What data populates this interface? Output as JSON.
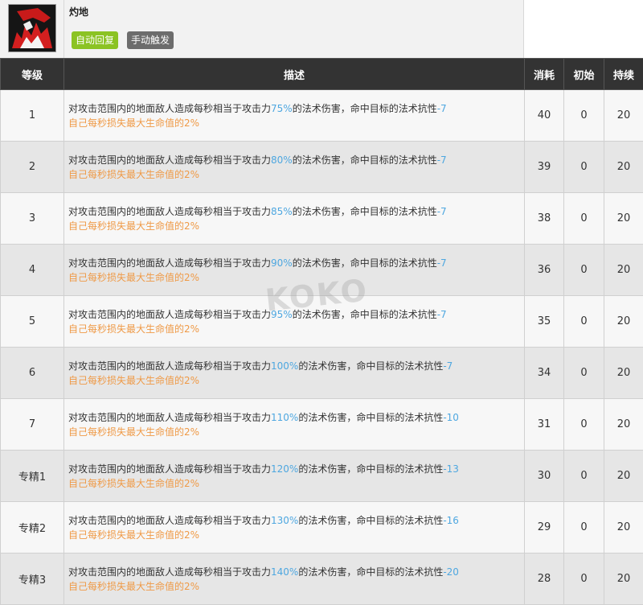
{
  "skill": {
    "name": "灼地",
    "tags": [
      "自动回复",
      "手动触发"
    ],
    "icon": "fire-skill-icon"
  },
  "table": {
    "headers": [
      "等级",
      "描述",
      "消耗",
      "初始",
      "持续"
    ],
    "rows": [
      {
        "level": "1",
        "desc_a": "对攻击范围内的地面敌人造成每秒相当于攻击力",
        "atk": "75%",
        "desc_b": "的法术伤害，命中目标的法术抗性",
        "res": "-7",
        "self": "自己每秒损失最大生命值的2%",
        "cost": "40",
        "init": "0",
        "dur": "20"
      },
      {
        "level": "2",
        "desc_a": "对攻击范围内的地面敌人造成每秒相当于攻击力",
        "atk": "80%",
        "desc_b": "的法术伤害，命中目标的法术抗性",
        "res": "-7",
        "self": "自己每秒损失最大生命值的2%",
        "cost": "39",
        "init": "0",
        "dur": "20"
      },
      {
        "level": "3",
        "desc_a": "对攻击范围内的地面敌人造成每秒相当于攻击力",
        "atk": "85%",
        "desc_b": "的法术伤害，命中目标的法术抗性",
        "res": "-7",
        "self": "自己每秒损失最大生命值的2%",
        "cost": "38",
        "init": "0",
        "dur": "20"
      },
      {
        "level": "4",
        "desc_a": "对攻击范围内的地面敌人造成每秒相当于攻击力",
        "atk": "90%",
        "desc_b": "的法术伤害，命中目标的法术抗性",
        "res": "-7",
        "self": "自己每秒损失最大生命值的2%",
        "cost": "36",
        "init": "0",
        "dur": "20"
      },
      {
        "level": "5",
        "desc_a": "对攻击范围内的地面敌人造成每秒相当于攻击力",
        "atk": "95%",
        "desc_b": "的法术伤害，命中目标的法术抗性",
        "res": "-7",
        "self": "自己每秒损失最大生命值的2%",
        "cost": "35",
        "init": "0",
        "dur": "20"
      },
      {
        "level": "6",
        "desc_a": "对攻击范围内的地面敌人造成每秒相当于攻击力",
        "atk": "100%",
        "desc_b": "的法术伤害，命中目标的法术抗性",
        "res": "-7",
        "self": "自己每秒损失最大生命值的2%",
        "cost": "34",
        "init": "0",
        "dur": "20"
      },
      {
        "level": "7",
        "desc_a": "对攻击范围内的地面敌人造成每秒相当于攻击力",
        "atk": "110%",
        "desc_b": "的法术伤害，命中目标的法术抗性",
        "res": "-10",
        "self": "自己每秒损失最大生命值的2%",
        "cost": "31",
        "init": "0",
        "dur": "20"
      },
      {
        "level": "专精1",
        "desc_a": "对攻击范围内的地面敌人造成每秒相当于攻击力",
        "atk": "120%",
        "desc_b": "的法术伤害，命中目标的法术抗性",
        "res": "-13",
        "self": "自己每秒损失最大生命值的2%",
        "cost": "30",
        "init": "0",
        "dur": "20"
      },
      {
        "level": "专精2",
        "desc_a": "对攻击范围内的地面敌人造成每秒相当于攻击力",
        "atk": "130%",
        "desc_b": "的法术伤害，命中目标的法术抗性",
        "res": "-16",
        "self": "自己每秒损失最大生命值的2%",
        "cost": "29",
        "init": "0",
        "dur": "20"
      },
      {
        "level": "专精3",
        "desc_a": "对攻击范围内的地面敌人造成每秒相当于攻击力",
        "atk": "140%",
        "desc_b": "的法术伤害，命中目标的法术抗性",
        "res": "-20",
        "self": "自己每秒损失最大生命值的2%",
        "cost": "28",
        "init": "0",
        "dur": "20"
      }
    ]
  },
  "watermark": "KOKO",
  "colors": {
    "header_bg": "#333333",
    "tag_recovery": "#8bc323",
    "tag_trigger": "#6c6c6c",
    "value_blue": "#4ea7e0",
    "value_orange": "#ef9a47"
  }
}
